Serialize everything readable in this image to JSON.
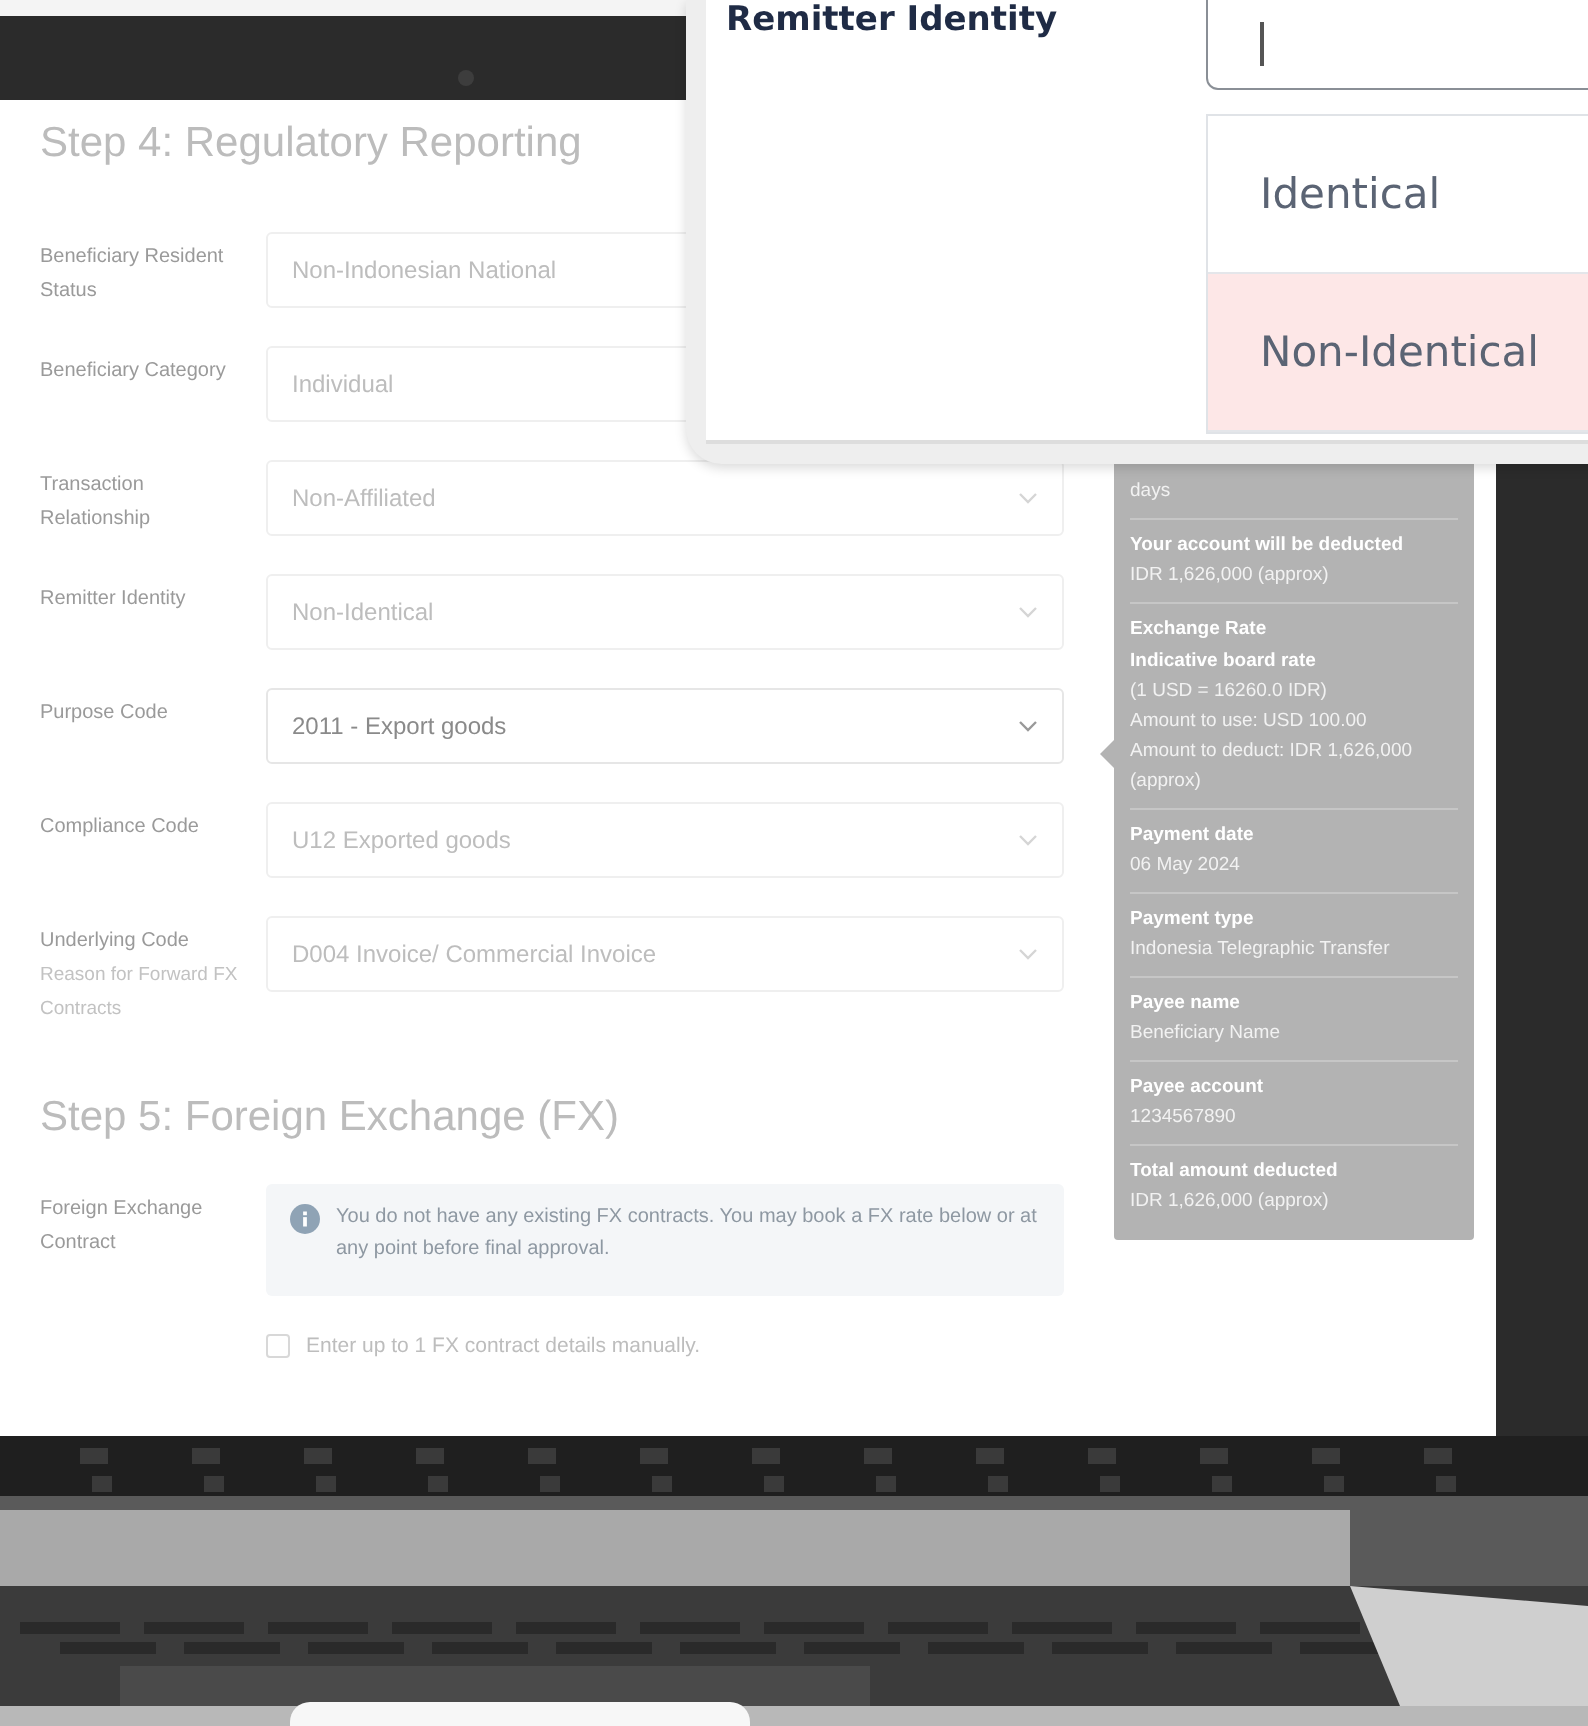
{
  "form": {
    "sections": [
      {
        "title": "Step 4: Regulatory Reporting",
        "fields": [
          {
            "kind": "select",
            "label": "Beneficiary Resident Status",
            "value": "Non-Indonesian National",
            "active": false
          },
          {
            "kind": "select",
            "label": "Beneficiary Category",
            "value": "Individual",
            "active": false
          },
          {
            "kind": "select",
            "label": "Transaction Relationship",
            "value": "Non-Affiliated",
            "active": false
          },
          {
            "kind": "select",
            "label": "Remitter Identity",
            "value": "Non-Identical",
            "active": false
          },
          {
            "kind": "select",
            "label": "Purpose Code",
            "value": "2011 - Export goods",
            "active": true
          },
          {
            "kind": "select",
            "label": "Compliance Code",
            "value": "U12 Exported goods",
            "active": false
          },
          {
            "kind": "select",
            "label": "Underlying Code",
            "hint": "Reason for Forward FX Contracts",
            "value": "D004 Invoice/ Commercial Invoice",
            "active": false
          }
        ]
      },
      {
        "title": "Step 5: Foreign Exchange (FX)",
        "fields": [
          {
            "kind": "info",
            "label": "Foreign Exchange Contract",
            "message": "You do not have any existing FX contracts. You may book a FX rate below or at any point before final approval."
          },
          {
            "kind": "checkbox",
            "label": "Enter up to 1 FX contract details manually.",
            "checked": false
          }
        ]
      }
    ]
  },
  "summary": {
    "items": [
      {
        "lines": [
          "days"
        ]
      },
      {
        "label": "Your account will be deducted",
        "lines": [
          "IDR 1,626,000 (approx)"
        ]
      },
      {
        "label": "Exchange Rate",
        "sublabel": "Indicative board rate",
        "lines": [
          "(1 USD = 16260.0 IDR)",
          "Amount to use: USD 100.00",
          "Amount to deduct: IDR 1,626,000",
          "(approx)"
        ]
      },
      {
        "label": "Payment date",
        "lines": [
          "06 May 2024"
        ]
      },
      {
        "label": "Payment type",
        "lines": [
          "Indonesia Telegraphic Transfer"
        ]
      },
      {
        "label": "Payee name",
        "lines": [
          "Beneficiary Name"
        ]
      },
      {
        "label": "Payee account",
        "lines": [
          "1234567890"
        ]
      },
      {
        "label": "Total amount deducted",
        "lines": [
          "IDR 1,626,000 (approx)"
        ]
      }
    ]
  },
  "popup": {
    "label": "Remitter Identity",
    "options": [
      {
        "label": "Identical",
        "selected": false
      },
      {
        "label": "Non-Identical",
        "selected": true
      }
    ]
  }
}
